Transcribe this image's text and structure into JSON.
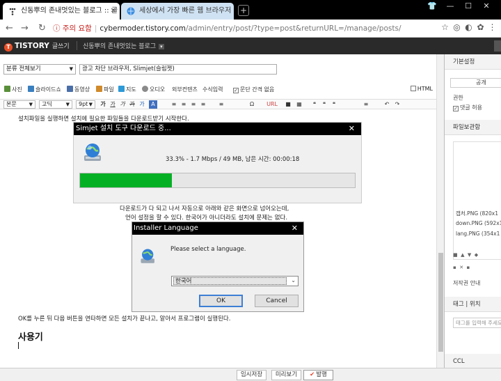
{
  "browser": {
    "tabs": [
      {
        "title": "신동뿌의 존내멋있는 블로그 :: 글",
        "active": true
      },
      {
        "title": "세상에서 가장 빠른 웹 브라우저",
        "active": false
      }
    ],
    "new_tab": "+",
    "window_controls": [
      "👕",
      "—",
      "☐",
      "✕"
    ],
    "address": {
      "warning": "주의 요함",
      "host": "cybermoder.tistory.com",
      "path": "/admin/entry/post/?type=post&returnURL=/manage/posts/"
    },
    "nav": {
      "back": "←",
      "forward": "→",
      "reload": "↻",
      "home": "⌂"
    },
    "ext": [
      "☆",
      "◎",
      "◐",
      "✿",
      "⋮"
    ]
  },
  "tistory": {
    "logo": "TISTORY",
    "logo_mark": "T",
    "mode": "글쓰기",
    "blog_name": "신동뿌의 존내멋있는 블로그",
    "blog_dd": "▾"
  },
  "editor": {
    "category": "분류 전체보기",
    "title": "광고 차단 브라우저, Slimjet(슬림젯)",
    "toolbar1": [
      "사진",
      "슬라이드쇼",
      "동영상",
      "파일",
      "지도",
      "오디오",
      "외부컨텐츠",
      "수식입력",
      "문단 간격 없음"
    ],
    "html_label": "HTML",
    "toolbar2": {
      "style": "본문",
      "font": "고딕",
      "size": "9pt",
      "buttons": [
        "가",
        "가",
        "가",
        "가",
        "가",
        "A",
        "≡",
        "≡",
        "≡",
        "≡",
        "≡",
        "Ω",
        "URL",
        "■",
        "▦",
        "❝",
        "❝",
        "❝",
        "≡",
        "↶",
        "↷"
      ]
    },
    "line1": "설치파일을 실행하면 설치에 필요한 파일들을 다운로드받기 시작한다.",
    "line2": "다운로드가 다 되고 나서 자동으로 아래와 같은 화면으로 넘어오는데,",
    "line3": "언어 설정을 할 수 있다. 한국어가 아니더라도 설치에 문제는 없다.",
    "line4": "OK를 누른 뒤 다음 버튼을 연타하면 모든 설치가 끝나고, 알아서 프로그램이 실행된다.",
    "heading": "사용기"
  },
  "simjet_dialog": {
    "title": "Simjet 설치 도구 다운로드 중...",
    "close": "✕",
    "status": "33.3% - 1.7 Mbps / 49 MB, 남은 시간: 00:00:18",
    "progress": 0.333,
    "progress_color": "#06b025"
  },
  "lang_dialog": {
    "title": "Installer Language",
    "close": "✕",
    "prompt": "Please select a language.",
    "selected": "한국어",
    "ok": "OK",
    "cancel": "Cancel"
  },
  "right_panel": {
    "basic": "기본설정",
    "visibility": "공개",
    "permission": "권한",
    "comment_allow": "댓글 허용",
    "files": "파일보관함",
    "file_list": [
      "캡처.PNG (820x1",
      "down.PNG (592x1",
      "lang.PNG (354x1"
    ],
    "copyright": "저작권 안내",
    "tags": "태그",
    "location": "위치",
    "tag_placeholder": "태그를 입력해 주세요",
    "ccl": "CCL"
  },
  "footer": {
    "save": "임시저장",
    "preview": "미리보기",
    "publish": "발행",
    "publish_mark": "✔"
  }
}
